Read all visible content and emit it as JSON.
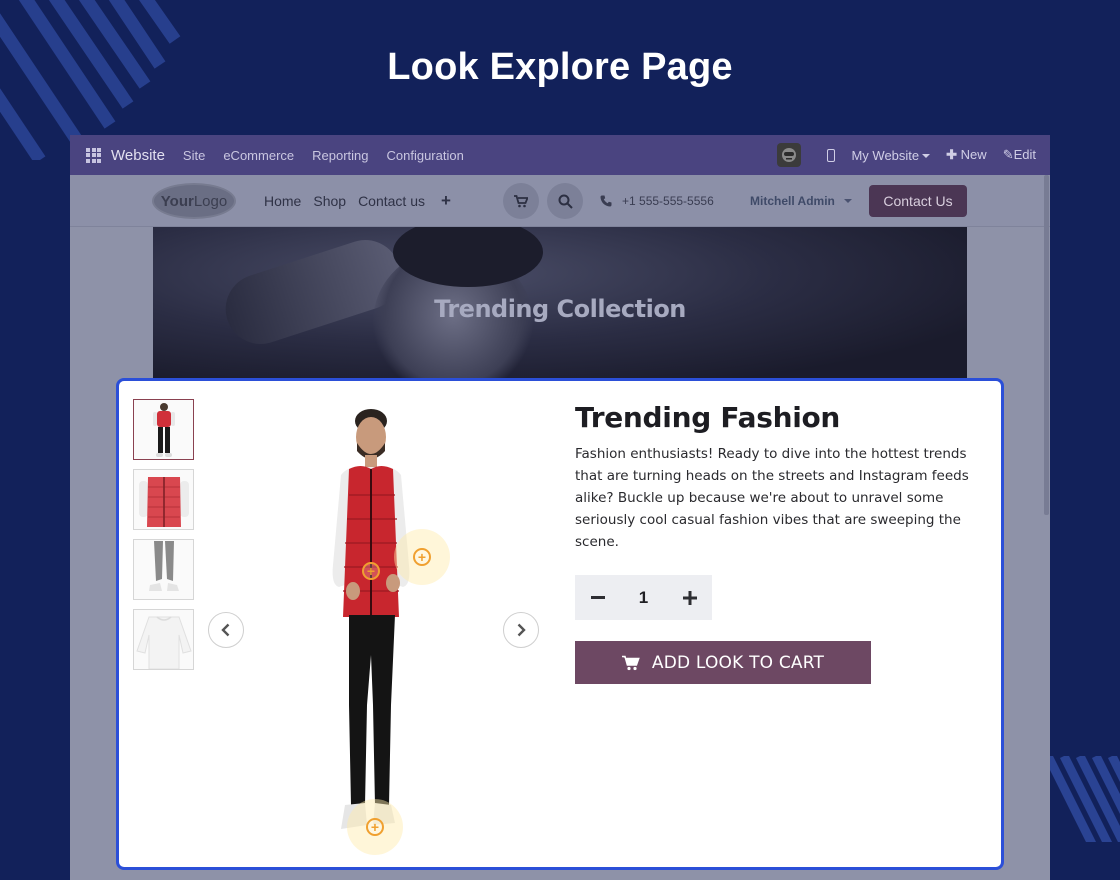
{
  "page_heading": "Look Explore Page",
  "colors": {
    "page_bg": "#12215a",
    "odoo_bar": "#4a4480",
    "modal_border": "#2b4fd8",
    "accent": "#6d4863",
    "hotspot": "#f0a030"
  },
  "odoo_bar": {
    "app_name": "Website",
    "menus": [
      "Site",
      "eCommerce",
      "Reporting",
      "Configuration"
    ],
    "website_selector": "My Website",
    "new_label": "New",
    "edit_label": "Edit"
  },
  "site_nav": {
    "logo_bold": "Your",
    "logo_light": "Logo",
    "links": [
      "Home",
      "Shop",
      "Contact us"
    ],
    "phone": "+1 555-555-5556",
    "user": "Mitchell Admin",
    "contact_button": "Contact Us"
  },
  "hero": {
    "title": "Trending Collection"
  },
  "modal": {
    "title": "Trending Fashion",
    "description": "Fashion enthusiasts! Ready to dive into the hottest trends that are turning heads on the streets and Instagram feeds alike? Buckle up because we're about to unravel some seriously cool casual fashion vibes that are sweeping the scene.",
    "quantity": "1",
    "add_to_cart": "ADD LOOK TO CART",
    "thumbnails": [
      "full-look-thumbnail",
      "red-vest-thumbnail",
      "grey-pants-thumbnail",
      "white-sweater-thumbnail"
    ],
    "icons": {
      "prev": "chevron-left-icon",
      "next": "chevron-right-icon",
      "cart": "cart-icon",
      "minus": "minus-icon",
      "plus": "plus-icon"
    }
  }
}
